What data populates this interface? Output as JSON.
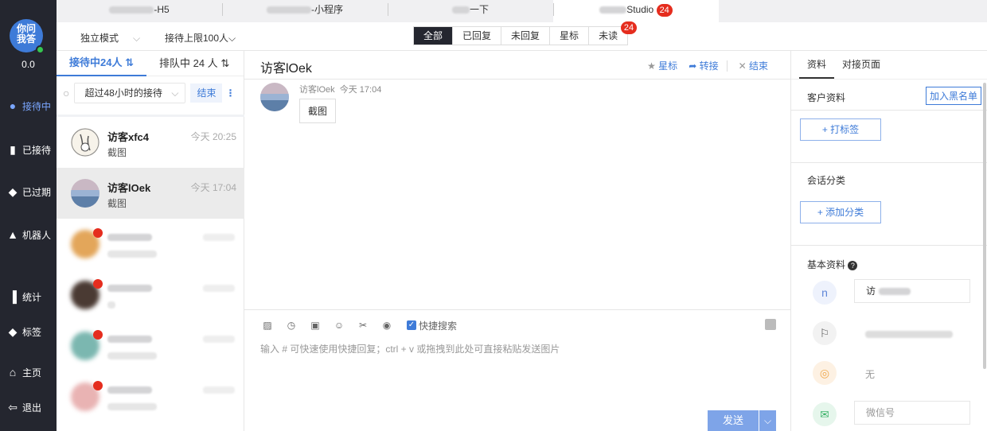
{
  "nav": {
    "logo_text": "你问我答",
    "score": "0.0",
    "items": [
      {
        "label": "接待中",
        "icon": "chat-bubble-icon",
        "active": true
      },
      {
        "label": "已接待",
        "icon": "thumbs-up-icon"
      },
      {
        "label": "已过期",
        "icon": "lightning-icon"
      },
      {
        "label": "机器人",
        "icon": "robot-icon"
      },
      {
        "label": "统计",
        "icon": "bar-chart-icon"
      },
      {
        "label": "标签",
        "icon": "tag-icon"
      },
      {
        "label": "主页",
        "icon": "home-icon"
      },
      {
        "label": "退出",
        "icon": "logout-icon"
      }
    ]
  },
  "top_tabs": [
    {
      "label": "-H5"
    },
    {
      "label": "-小程序"
    },
    {
      "label": "一下"
    },
    {
      "label": "Studio",
      "badge": "24"
    }
  ],
  "subbar": {
    "mode": "独立模式",
    "limit": "接待上限100人",
    "filters": [
      {
        "label": "全部",
        "active": true
      },
      {
        "label": "已回复"
      },
      {
        "label": "未回复"
      },
      {
        "label": "星标"
      },
      {
        "label": "未读",
        "badge": "24"
      }
    ]
  },
  "list": {
    "tab_serving": "接待中24人",
    "tab_queue": "排队中 24 人",
    "time_filter": "超过48小时的接待",
    "end_label": "结束",
    "conversations": [
      {
        "name": "访客xfc4",
        "time": "今天 20:25",
        "preview": "截图"
      },
      {
        "name": "访客lOek",
        "time": "今天 17:04",
        "preview": "截图"
      }
    ]
  },
  "chat": {
    "title": "访客lOek",
    "star_label": "星标",
    "transfer_label": "转接",
    "end_label": "结束",
    "message": {
      "sender": "访客lOek",
      "time": "今天 17:04",
      "text": "截图"
    },
    "quick_search_label": "快捷搜索",
    "input_placeholder": "输入 # 可快速使用快捷回复；ctrl + v 或拖拽到此处可直接粘贴发送图片",
    "send_label": "发送"
  },
  "right": {
    "tab_profile": "资料",
    "tab_page": "对接页面",
    "customer_info": "客户资料",
    "blacklist_label": "加入黑名单",
    "add_tag_label": "+ 打标签",
    "session_category": "会话分类",
    "add_category_label": "+ 添加分类",
    "basic_info": "基本资料",
    "name_value": "访",
    "location_value": "无",
    "wechat_placeholder": "微信号"
  }
}
